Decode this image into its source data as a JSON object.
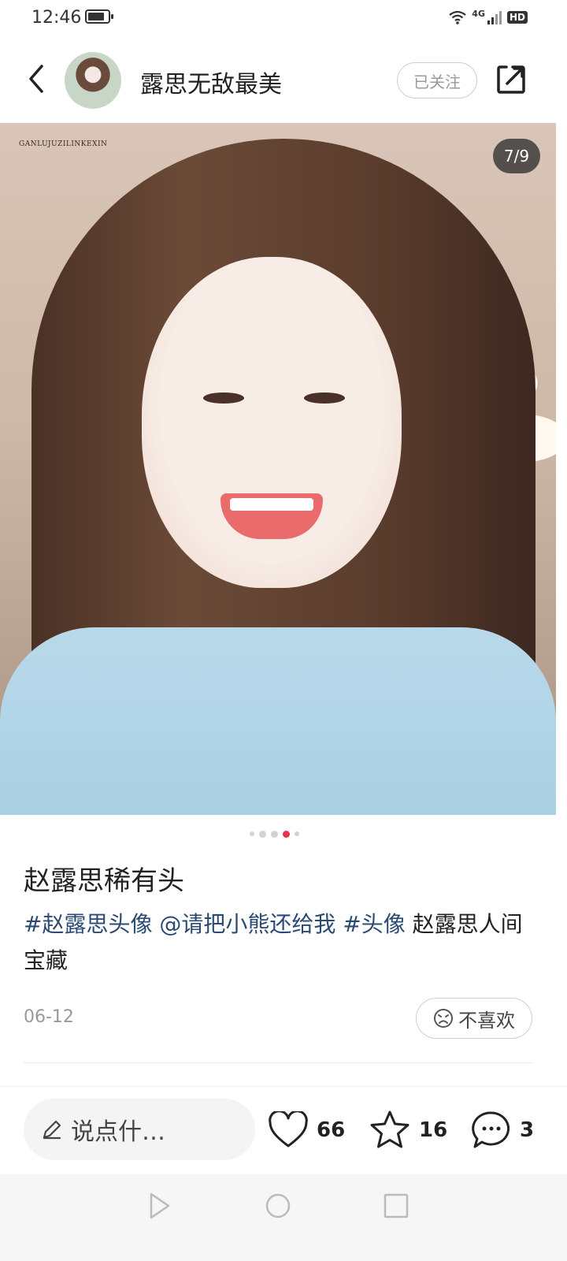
{
  "status_bar": {
    "time": "12:46",
    "network": "4G",
    "hd": "HD"
  },
  "header": {
    "username": "露思无敌最美",
    "follow_label": "已关注"
  },
  "photo": {
    "watermark": "GANLUJUZILINKEXIN",
    "page_counter": "7/9",
    "current_page": 7,
    "total_pages": 9
  },
  "carousel": {
    "dot_count": 5,
    "active_index": 3
  },
  "post": {
    "title": "赵露思稀有头",
    "tag1": "#赵露思头像",
    "mention": "@请把小熊还给我",
    "tag2": "#头像",
    "text": "赵露思人间宝藏",
    "date": "06-12",
    "dislike_label": "不喜欢"
  },
  "actions": {
    "comment_placeholder": "说点什…",
    "like_count": "66",
    "favorite_count": "16",
    "comment_count": "3"
  },
  "colors": {
    "accent": "#e8334a",
    "tag": "#2a4a73"
  },
  "icons": [
    "back-icon",
    "share-icon",
    "emoji-sad-icon",
    "pencil-icon",
    "heart-icon",
    "star-icon",
    "comment-icon",
    "nav-back-icon",
    "nav-home-icon",
    "nav-recent-icon"
  ]
}
